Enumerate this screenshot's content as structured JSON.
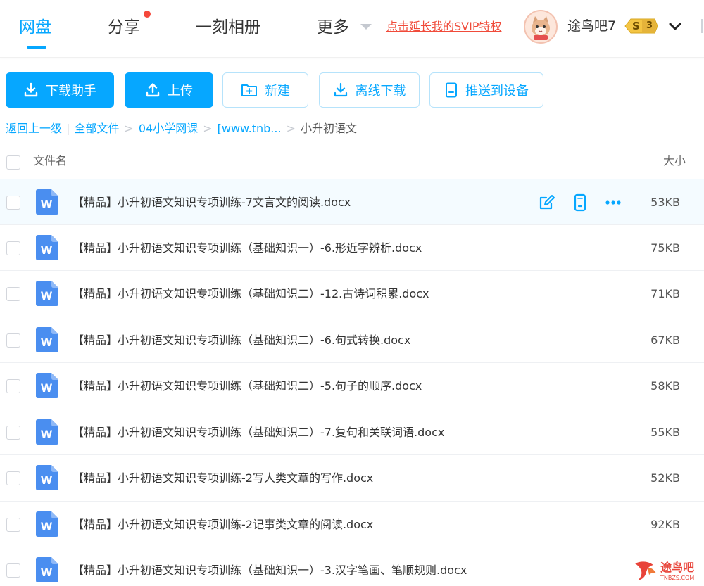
{
  "nav": {
    "tabs": [
      {
        "label": "网盘",
        "active": true
      },
      {
        "label": "分享",
        "has_notification_dot": true
      },
      {
        "label": "一刻相册"
      },
      {
        "label": "更多"
      }
    ],
    "svip_link": "点击延长我的SVIP特权",
    "username": "途鸟吧7",
    "level_badge": {
      "letter": "S",
      "number": "3"
    },
    "icons": {
      "avatar": "cat-avatar-icon",
      "expand": "chevron-down-icon",
      "more": "caret-down-icon"
    }
  },
  "toolbar": {
    "buttons": [
      {
        "label": "下载助手",
        "style": "primary",
        "icon": "download-icon"
      },
      {
        "label": "上传",
        "style": "primary",
        "icon": "upload-icon"
      },
      {
        "label": "新建",
        "style": "outline",
        "icon": "new-folder-icon"
      },
      {
        "label": "离线下载",
        "style": "outline",
        "icon": "download-icon"
      },
      {
        "label": "推送到设备",
        "style": "outline",
        "icon": "device-icon"
      }
    ]
  },
  "breadcrumb": {
    "back": "返回上一级",
    "separator": "|",
    "arrow": ">",
    "items": [
      "全部文件",
      "04小学网课",
      "[www.tnb..."
    ],
    "current": "小升初语文"
  },
  "list": {
    "columns": {
      "name": "文件名",
      "size": "大小"
    },
    "rows": [
      {
        "name": "【精品】小升初语文知识专项训练-7文言文的阅读.docx",
        "size": "53KB",
        "hovered": true
      },
      {
        "name": "【精品】小升初语文知识专项训练（基础知识一）-6.形近字辨析.docx",
        "size": "75KB"
      },
      {
        "name": "【精品】小升初语文知识专项训练（基础知识二）-12.古诗词积累.docx",
        "size": "71KB"
      },
      {
        "name": "【精品】小升初语文知识专项训练（基础知识二）-6.句式转换.docx",
        "size": "67KB"
      },
      {
        "name": "【精品】小升初语文知识专项训练（基础知识二）-5.句子的顺序.docx",
        "size": "58KB"
      },
      {
        "name": "【精品】小升初语文知识专项训练（基础知识二）-7.复句和关联词语.docx",
        "size": "55KB"
      },
      {
        "name": "【精品】小升初语文知识专项训练-2写人类文章的写作.docx",
        "size": "52KB"
      },
      {
        "name": "【精品】小升初语文知识专项训练-2记事类文章的阅读.docx",
        "size": "92KB"
      },
      {
        "name": "【精品】小升初语文知识专项训练（基础知识一）-3.汉字笔画、笔顺规则.docx",
        "size": ""
      }
    ],
    "file_icon_letter": "W",
    "row_action_icons": [
      "edit-icon",
      "phone-icon",
      "more-dots-icon"
    ]
  },
  "watermark": {
    "text": "途鸟吧",
    "sub": "TNBZS.COM"
  },
  "colors": {
    "accent": "#06a7ff",
    "svip": "#f04b3a",
    "word": "#4a8ef0",
    "notification": "#f5483b"
  }
}
